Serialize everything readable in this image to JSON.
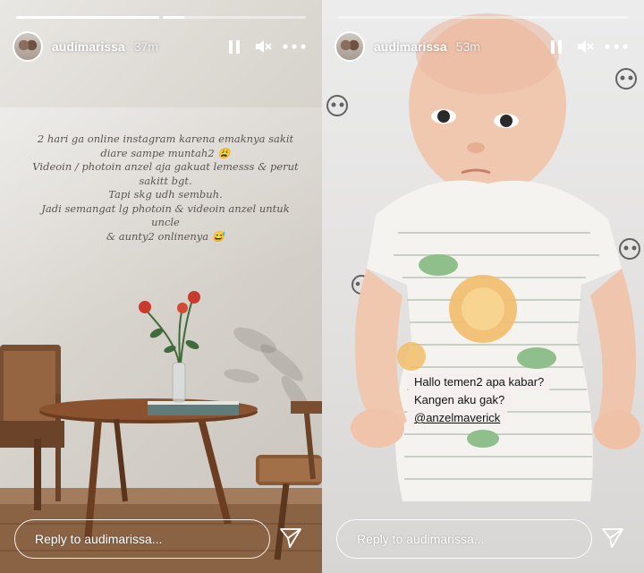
{
  "stories": [
    {
      "username": "audimarissa",
      "time": "37m",
      "progress": [
        1.0,
        0.15
      ],
      "caption_lines": [
        "2 hari ga online instagram karena emaknya sakit",
        "diare sampe muntah2 😩",
        "Videoin / photoin anzel aja gakuat lemesss & perut",
        "sakitt bgt.",
        "Tapi skg udh sembuh.",
        "Jadi semangat lg photoin & videoin anzel untuk uncle",
        "& aunty2 onlinenya 😅"
      ],
      "reply_placeholder": "Reply to audimarissa..."
    },
    {
      "username": "audimarissa",
      "time": "53m",
      "progress": [
        0.0
      ],
      "sticker_lines": [
        "Hallo temen2 apa kabar?",
        "Kangen aku gak?",
        "@anzelmaverick"
      ],
      "reply_placeholder": "Reply to audimarissa..."
    }
  ],
  "icons": {
    "pause": "pause-icon",
    "mute": "speaker-muted-icon",
    "more": "more-icon",
    "send": "send-icon"
  },
  "colors": {
    "ui_white": "#ffffff",
    "caption_text": "#5a5450",
    "sticker_bg": "#f5f0ef"
  }
}
